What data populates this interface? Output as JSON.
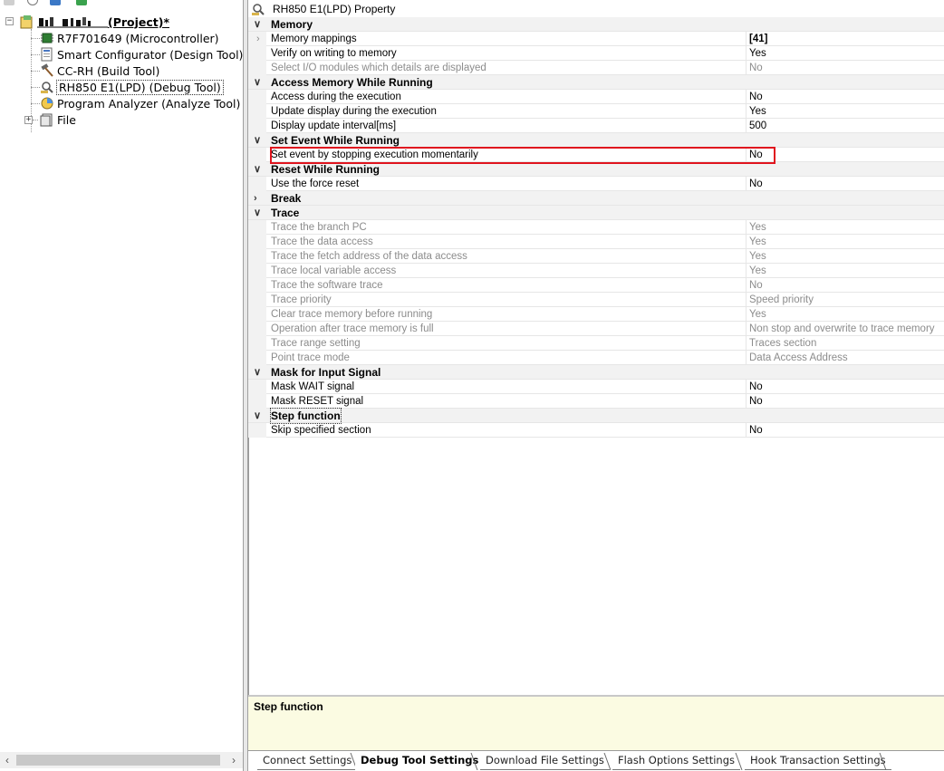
{
  "tree": {
    "project_label": "(Project)*",
    "items": [
      {
        "label": "R7F701649 (Microcontroller)",
        "icon": "microcontroller-icon"
      },
      {
        "label": "Smart Configurator (Design Tool)",
        "icon": "design-tool-icon"
      },
      {
        "label": "CC-RH (Build Tool)",
        "icon": "hammer-icon"
      },
      {
        "label": "RH850 E1(LPD) (Debug Tool)",
        "icon": "debug-tool-icon"
      },
      {
        "label": "Program Analyzer (Analyze Tool)",
        "icon": "analyzer-icon"
      },
      {
        "label": "File",
        "icon": "folder-icon"
      }
    ]
  },
  "panel": {
    "title": "RH850 E1(LPD) Property"
  },
  "properties": [
    {
      "type": "category",
      "label": "Memory",
      "expanded": true
    },
    {
      "type": "sub",
      "label": "Memory mappings",
      "value": "[41]",
      "bold": true
    },
    {
      "type": "item",
      "label": "Verify on writing to memory",
      "value": "Yes"
    },
    {
      "type": "item",
      "label": "Select I/O modules which details are displayed",
      "value": "No",
      "disabled": true
    },
    {
      "type": "category",
      "label": "Access Memory While Running",
      "expanded": true
    },
    {
      "type": "item",
      "label": "Access during the execution",
      "value": "No"
    },
    {
      "type": "item",
      "label": "Update display during the execution",
      "value": "Yes"
    },
    {
      "type": "item",
      "label": "Display update interval[ms]",
      "value": "500"
    },
    {
      "type": "category",
      "label": "Set Event While Running",
      "expanded": true
    },
    {
      "type": "item",
      "label": "Set event by stopping execution momentarily",
      "value": "No"
    },
    {
      "type": "category",
      "label": "Reset While Running",
      "expanded": true
    },
    {
      "type": "item",
      "label": "Use the force reset",
      "value": "No"
    },
    {
      "type": "category",
      "label": "Break",
      "expanded": false
    },
    {
      "type": "category",
      "label": "Trace",
      "expanded": true
    },
    {
      "type": "item",
      "label": "Trace the branch PC",
      "value": "Yes",
      "disabled": true
    },
    {
      "type": "item",
      "label": "Trace the data access",
      "value": "Yes",
      "disabled": true
    },
    {
      "type": "item",
      "label": "Trace the fetch address of the data access",
      "value": "Yes",
      "disabled": true
    },
    {
      "type": "item",
      "label": "Trace local variable access",
      "value": "Yes",
      "disabled": true
    },
    {
      "type": "item",
      "label": "Trace the software trace",
      "value": "No",
      "disabled": true
    },
    {
      "type": "item",
      "label": "Trace priority",
      "value": "Speed priority",
      "disabled": true
    },
    {
      "type": "item",
      "label": "Clear trace memory before running",
      "value": "Yes",
      "disabled": true
    },
    {
      "type": "item",
      "label": "Operation after trace memory is full",
      "value": "Non stop and overwrite to trace memory",
      "disabled": true
    },
    {
      "type": "item",
      "label": "Trace range setting",
      "value": "Traces section",
      "disabled": true
    },
    {
      "type": "item",
      "label": "Point trace mode",
      "value": "Data Access Address",
      "disabled": true
    },
    {
      "type": "category",
      "label": "Mask for Input Signal",
      "expanded": true
    },
    {
      "type": "item",
      "label": "Mask WAIT signal",
      "value": "No"
    },
    {
      "type": "item",
      "label": "Mask RESET signal",
      "value": "No"
    },
    {
      "type": "category",
      "label": "Step function",
      "expanded": true,
      "focused": true
    },
    {
      "type": "item",
      "label": "Skip specified section",
      "value": "No"
    }
  ],
  "description": {
    "title": "Step function"
  },
  "tabs": [
    {
      "label": "Connect Settings",
      "active": false
    },
    {
      "label": "Debug Tool Settings",
      "active": true
    },
    {
      "label": "Download File Settings",
      "active": false
    },
    {
      "label": "Flash Options Settings",
      "active": false
    },
    {
      "label": "Hook Transaction Settings",
      "active": false
    }
  ],
  "colors": {
    "highlight": "#e0141e",
    "description_bg": "#fbfbe2",
    "disabled_text": "#8c8c8c"
  }
}
